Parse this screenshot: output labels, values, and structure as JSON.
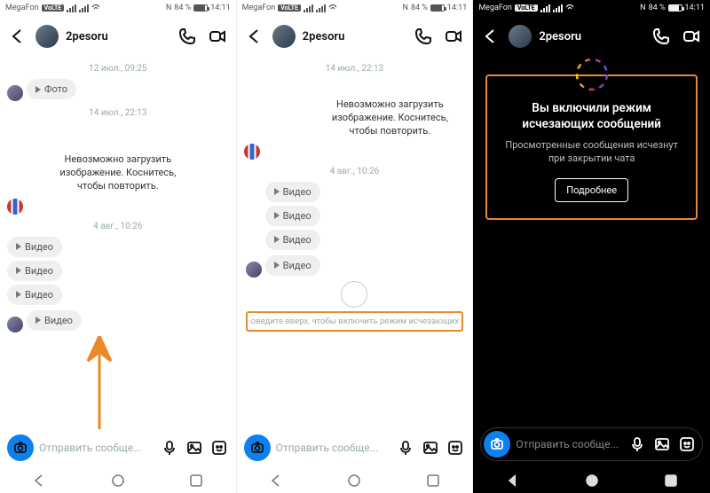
{
  "status": {
    "carrier": "MegaFon",
    "carrier_tag": "VoLTE",
    "nfc": "N",
    "battery": "84 %",
    "time": "14:11"
  },
  "header": {
    "username": "2pesoru"
  },
  "chat1": {
    "ts1": "12 июл., 09:25",
    "photo": "Фото",
    "ts2": "14 июл., 22:13",
    "err": "Невозможно загрузить изображение. Коснитесь, чтобы повторить.",
    "ts3": "4 авг., 10:26",
    "video": "Видео"
  },
  "chat2": {
    "ts1": "14 июл., 22:13",
    "err": "Невозможно загрузить изображение. Коснитесь, чтобы повторить.",
    "ts2": "4 авг., 10:26",
    "video": "Видео",
    "hint": "оведите вверх, чтобы включить режим исчезающих сообщений"
  },
  "vanish": {
    "title": "Вы включили режим исчезающих сообщений",
    "sub": "Просмотренные сообщения исчезнут при закрытии чата",
    "more": "Подробнее"
  },
  "input": {
    "placeholder": "Отправить сообще..."
  }
}
